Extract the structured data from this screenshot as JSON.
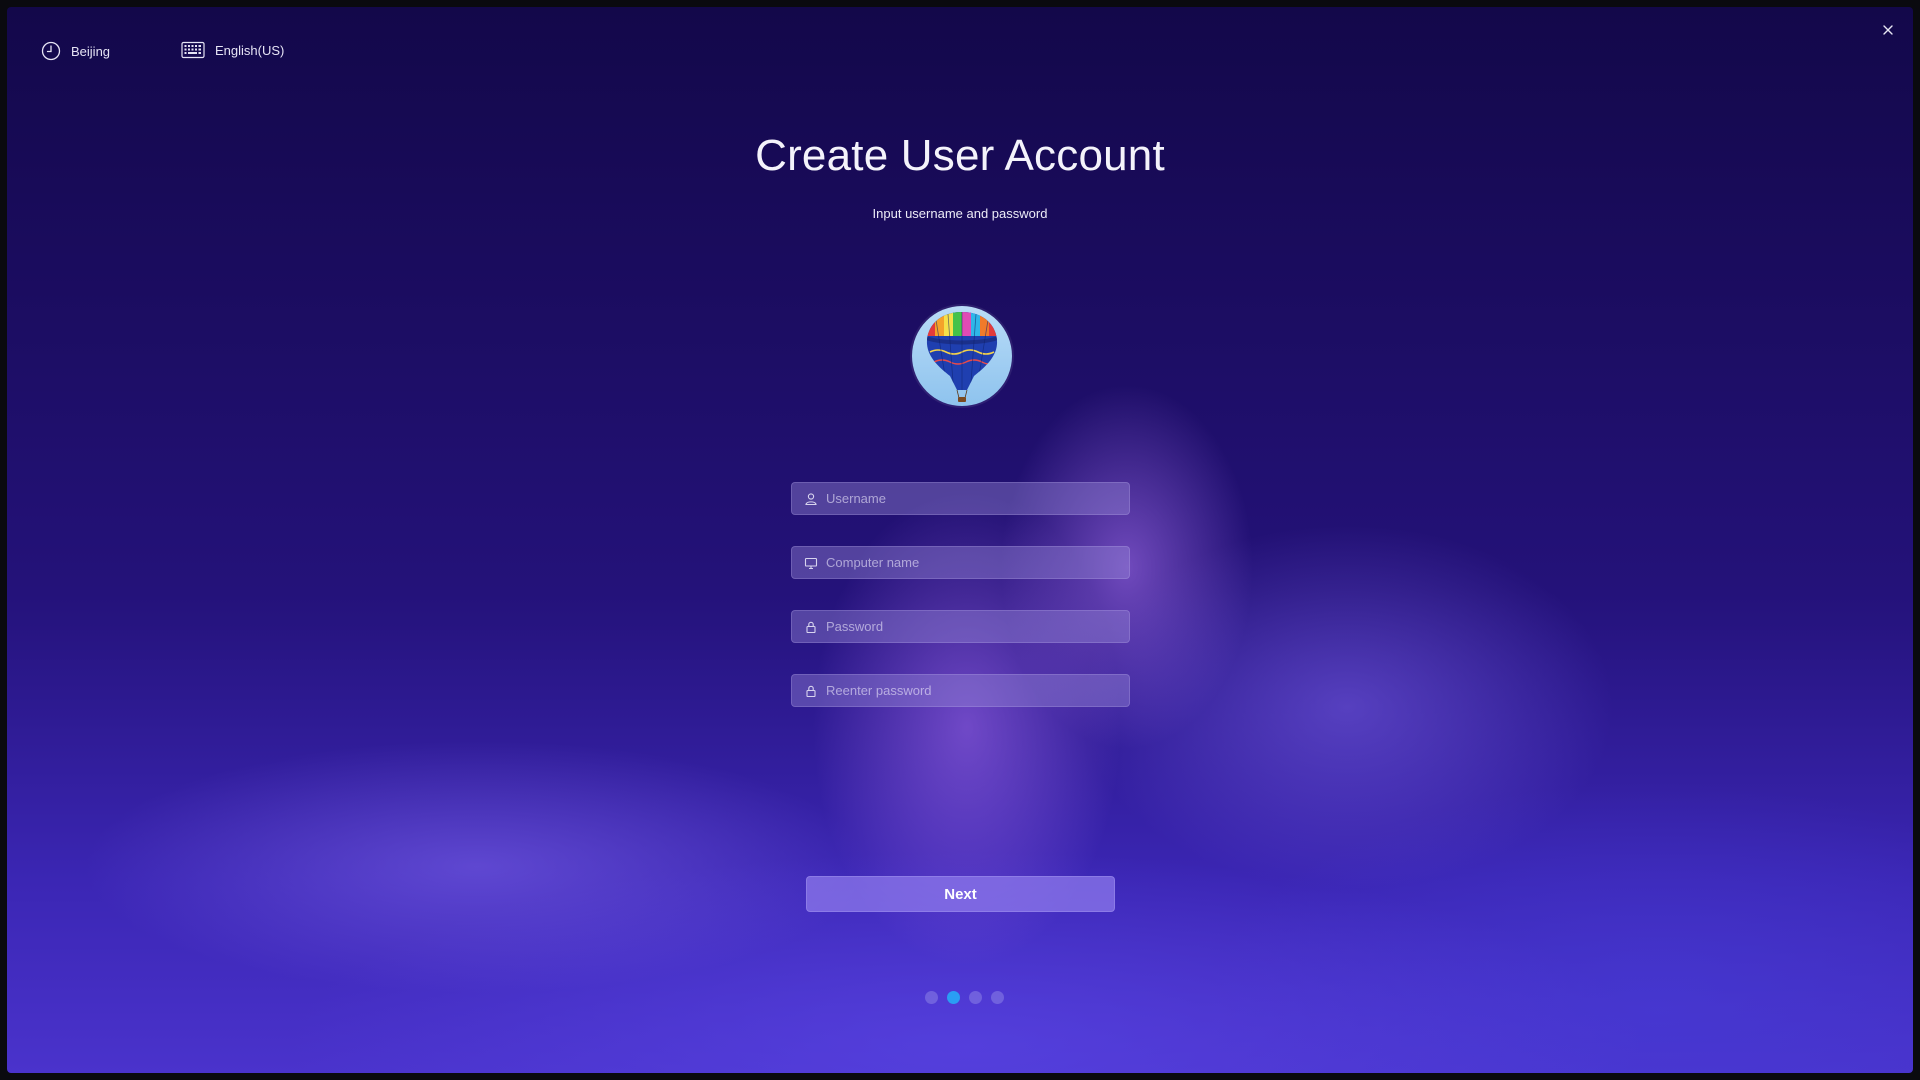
{
  "topbar": {
    "timezone_label": "Beijing",
    "keyboard_label": "English(US)"
  },
  "header": {
    "title": "Create User Account",
    "subtitle": "Input username and password"
  },
  "form": {
    "username_placeholder": "Username",
    "computer_name_placeholder": "Computer name",
    "password_placeholder": "Password",
    "reenter_password_placeholder": "Reenter password",
    "username_value": "",
    "computer_name_value": "",
    "password_value": "",
    "reenter_password_value": ""
  },
  "actions": {
    "next_label": "Next"
  },
  "progress": {
    "total_steps": 4,
    "current_step": 2
  },
  "icons": {
    "timezone": "clock-icon",
    "keyboard": "keyboard-icon",
    "close": "close-icon",
    "username": "user-icon",
    "computer": "monitor-icon",
    "password": "lock-icon",
    "avatar": "hot-air-balloon-avatar"
  },
  "colors": {
    "accent_active_dot": "#2a9df4",
    "button_bg": "#8c78eb"
  }
}
